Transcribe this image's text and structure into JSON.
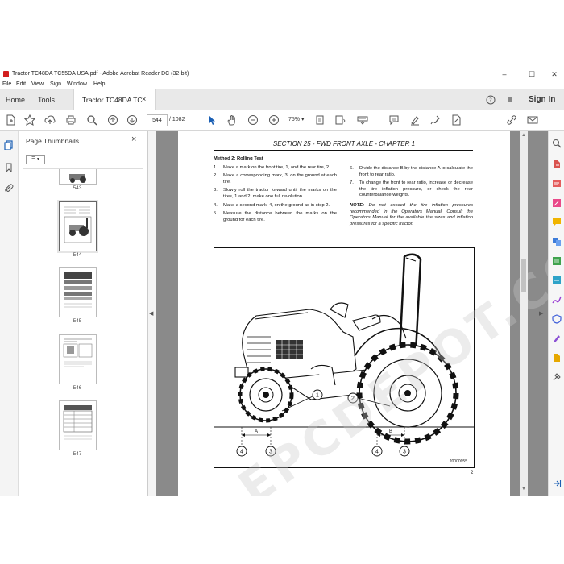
{
  "window": {
    "title": "Tractor TC48DA TC55DA USA.pdf - Adobe Acrobat Reader DC (32-bit)",
    "minimize": "–",
    "maximize": "☐",
    "close": "✕"
  },
  "menu": [
    "File",
    "Edit",
    "View",
    "Sign",
    "Window",
    "Help"
  ],
  "tabs": {
    "home": "Home",
    "tools": "Tools",
    "document": "Tractor TC48DA TC...",
    "document_close": "×",
    "sign_in": "Sign In"
  },
  "toolbar": {
    "page_current": "544",
    "page_total": "/ 1082",
    "zoom": "75%"
  },
  "thumbnails": {
    "title": "Page Thumbnails",
    "close": "×",
    "options": "☰ ▾",
    "pages": [
      "543",
      "544",
      "545",
      "546",
      "547"
    ],
    "selected": "544"
  },
  "document": {
    "section_header": "SECTION 25 - FWD FRONT AXLE - CHAPTER 1",
    "method_title": "Method 2: Rolling Test",
    "steps_left": [
      {
        "n": "1.",
        "text": "Make a mark on the front tire, 1, and the rear tire, 2."
      },
      {
        "n": "2.",
        "text": "Make a corresponding mark, 3, on the ground at each tire."
      },
      {
        "n": "3.",
        "text": "Slowly roll the tractor forward until the marks on the tires, 1 and 2, make one full revolution."
      },
      {
        "n": "4.",
        "text": "Make a second mark, 4, on the ground as in step 2."
      },
      {
        "n": "5.",
        "text": "Measure the distance between the marks on the ground for each tire."
      }
    ],
    "steps_right": [
      {
        "n": "6.",
        "text": "Divide the distance B by the distance A to calculate the front to rear ratio."
      },
      {
        "n": "7.",
        "text": "To change the front to rear ratio, increase or decrease the tire inflation pressure, or check the rear counterbalance weights."
      }
    ],
    "note_label": "NOTE:",
    "note_text": "Do not exceed the tire inflation pressures recommended in the Operators Manual. Consult the Operators Manual for the available tire sizes and inflation pressures for a specific tractor.",
    "figure": {
      "callout_1": "1",
      "callout_2": "2",
      "marker_4a": "4",
      "marker_3a": "3",
      "marker_4b": "4",
      "marker_3b": "3",
      "dim_a": "A",
      "dim_b": "B",
      "figure_id": "20000955"
    },
    "page_number": "2",
    "watermark": "EPCDEPOT.COM"
  },
  "colors": {
    "acrobat_red": "#d21f1f",
    "doc_background": "#8a8a8a",
    "icon_gray": "#555555"
  }
}
